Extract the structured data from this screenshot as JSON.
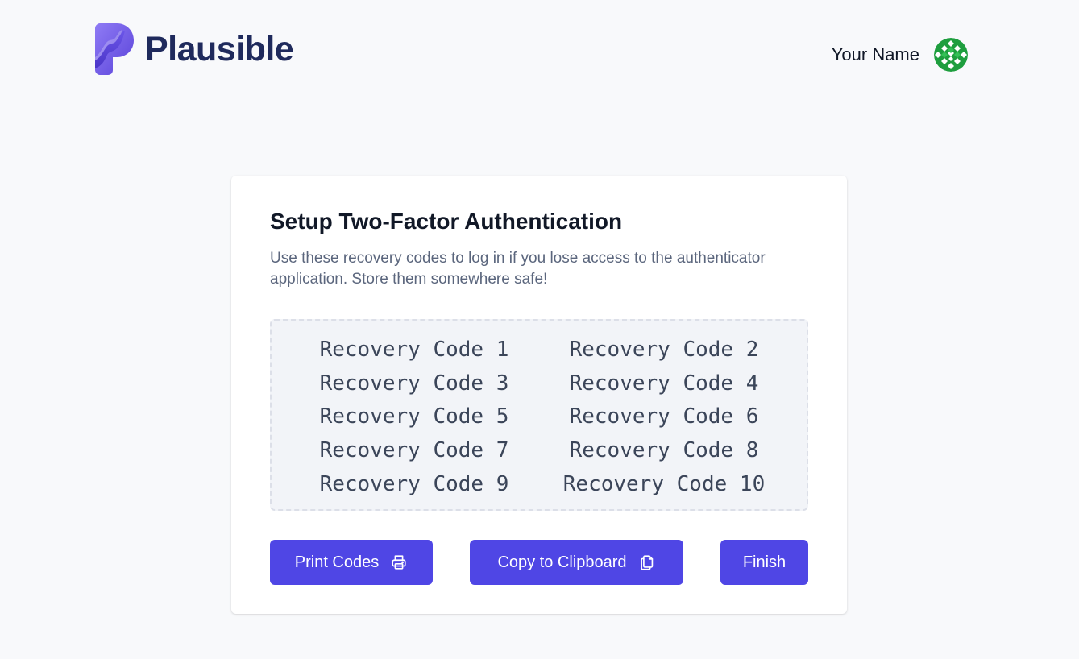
{
  "header": {
    "brand_name": "Plausible",
    "user_name": "Your Name"
  },
  "card": {
    "title": "Setup Two-Factor Authentication",
    "description": "Use these recovery codes to log in if you lose access to the authenticator application. Store them somewhere safe!",
    "codes": [
      "Recovery Code 1",
      "Recovery Code 2",
      "Recovery Code 3",
      "Recovery Code 4",
      "Recovery Code 5",
      "Recovery Code 6",
      "Recovery Code 7",
      "Recovery Code 8",
      "Recovery Code 9",
      "Recovery Code 10"
    ]
  },
  "actions": {
    "print_label": "Print Codes",
    "print_icon": "printer-icon",
    "copy_label": "Copy to Clipboard",
    "copy_icon": "clipboard-copy-icon",
    "finish_label": "Finish"
  },
  "colors": {
    "accent": "#4f46e5",
    "brand": "#1f2a5c",
    "background": "#f8f9fb"
  }
}
